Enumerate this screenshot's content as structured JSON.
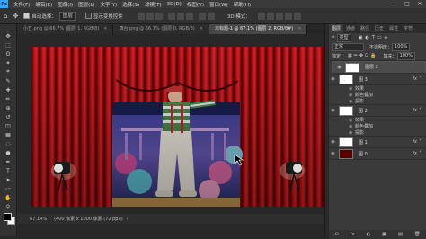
{
  "menubar": {
    "items": [
      "文件(F)",
      "编辑(E)",
      "图像(I)",
      "图层(L)",
      "文字(Y)",
      "选择(S)",
      "滤镜(T)",
      "3D(D)",
      "视图(V)",
      "窗口(W)",
      "帮助(H)"
    ],
    "app_badge": "Ps",
    "window_controls": [
      "–",
      "□",
      "✕"
    ]
  },
  "options_bar": {
    "auto_select_label": "自动选择：",
    "auto_select_value": "图层",
    "show_transform_label": "显示变换控件",
    "mode_label": "3D 模式："
  },
  "tabs": [
    {
      "label": "小丑.png @ 66.7% (图层 1, RGB/8)",
      "active": false
    },
    {
      "label": "舞台.png @ 66.7% (图层 0, RGB/8)",
      "active": false
    },
    {
      "label": "未标题-1 @ 67.1% (图层 2, RGB/8#)",
      "active": true
    }
  ],
  "status": {
    "zoom": "67.14%",
    "doc_size": "(400 像素 x 1000 像素 (72 ppi))"
  },
  "panel": {
    "tabs": [
      "图层",
      "通道",
      "路径",
      "历史",
      "属性",
      "字符"
    ],
    "kind_filter": "类型",
    "blend_mode": "正常",
    "opacity_label": "不透明度：",
    "opacity_value": "100%",
    "lock_label": "锁定：",
    "fill_label": "填充：",
    "fill_value": "100%",
    "layers": [
      {
        "name": "图层 2",
        "thumb": "white",
        "fx": false,
        "selected": true
      },
      {
        "name": "图 3",
        "thumb": "white",
        "fx": true,
        "selected": false,
        "effects": [
          "效果",
          "颜色叠加",
          "投影"
        ]
      },
      {
        "name": "图 2",
        "thumb": "white",
        "fx": true,
        "selected": false,
        "effects": [
          "效果",
          "颜色叠加",
          "投影"
        ]
      },
      {
        "name": "图 1",
        "thumb": "white",
        "fx": true,
        "selected": false
      },
      {
        "name": "图 0",
        "thumb": "dark",
        "fx": true,
        "selected": false
      }
    ],
    "bottom_icons": [
      "⊝",
      "fx",
      "◐",
      "▣",
      "▤",
      "🗑"
    ]
  },
  "toolbar": {
    "tools": [
      "move-tool",
      "marquee-tool",
      "lasso-tool",
      "magic-wand-tool",
      "crop-tool",
      "eyedropper-tool",
      "healing-tool",
      "brush-tool",
      "stamp-tool",
      "history-brush-tool",
      "eraser-tool",
      "gradient-tool",
      "blur-tool",
      "dodge-tool",
      "pen-tool",
      "type-tool",
      "path-select-tool",
      "shape-tool",
      "hand-tool",
      "zoom-tool"
    ],
    "glyphs": [
      "✥",
      "⬚",
      "ʘ",
      "✦",
      "⌗",
      "✎",
      "✚",
      "✏",
      "⊕",
      "↺",
      "◫",
      "▦",
      "◌",
      "●",
      "✒",
      "T",
      "➤",
      "▭",
      "✋",
      "⚲"
    ]
  }
}
